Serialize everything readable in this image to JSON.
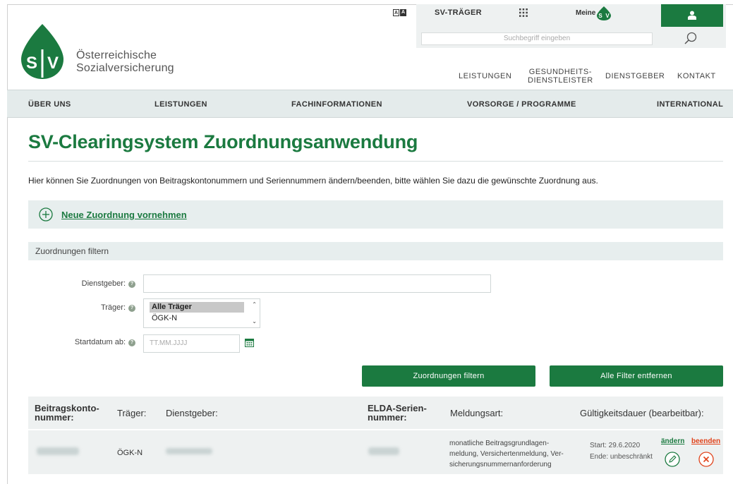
{
  "header": {
    "brand_line1": "Österreichische",
    "brand_line2": "Sozialversicherung",
    "logo_text": "SV",
    "sv_traeger": "SV-TRÄGER",
    "meine_label": "Meine",
    "search_placeholder": "Suchbegriff eingeben",
    "top_nav": [
      {
        "label": "LEISTUNGEN"
      },
      {
        "label1": "GESUNDHEITS-",
        "label2": "DIENSTLEISTER"
      },
      {
        "label": "DIENSTGEBER"
      },
      {
        "label": "KONTAKT"
      }
    ]
  },
  "main_nav": [
    "ÜBER UNS",
    "LEISTUNGEN",
    "FACHINFORMATIONEN",
    "VORSORGE / PROGRAMME",
    "INTERNATIONAL"
  ],
  "page": {
    "title": "SV-Clearingsystem Zuordnungsanwendung",
    "intro": "Hier können Sie Zuordnungen von Beitragskontonummern und Seriennummern ändern/beenden, bitte wählen Sie dazu die gewünschte Zuordnung aus.",
    "new_link": "Neue Zuordnung vornehmen"
  },
  "filter": {
    "heading": "Zuordnungen filtern",
    "dienstgeber_label": "Dienstgeber:",
    "traeger_label": "Träger:",
    "traeger_options": [
      "Alle Träger",
      "ÖGK-N"
    ],
    "startdatum_label": "Startdatum ab:",
    "date_placeholder": "TT.MM.JJJJ",
    "help": "?",
    "filter_button": "Zuordnungen filtern",
    "clear_button": "Alle Filter entfernen"
  },
  "table": {
    "headers": {
      "konto1": "Beitragskonto-",
      "konto2": "nummer:",
      "traeger": "Träger:",
      "dienstgeber": "Dienstgeber:",
      "elda1": "ELDA-Serien-",
      "elda2": "nummer:",
      "meldungsart": "Meldungsart:",
      "gueltigkeit": "Gültigkeitsdauer (bearbeitbar):"
    },
    "rows": [
      {
        "traeger": "ÖGK-N",
        "meldungsart1": "monatliche Beitragsgrundlagen-",
        "meldungsart2": "meldung, Versichertenmeldung, Ver-",
        "meldungsart3": "sicherungsnummernanforderung",
        "start": "Start: 29.6.2020",
        "ende": "Ende: unbeschränkt",
        "edit_label": "ändern",
        "end_label": "beenden"
      }
    ]
  },
  "colors": {
    "primary_green": "#1b7a40",
    "end_red": "#e0421a",
    "panel_bg": "#e7eeee"
  }
}
